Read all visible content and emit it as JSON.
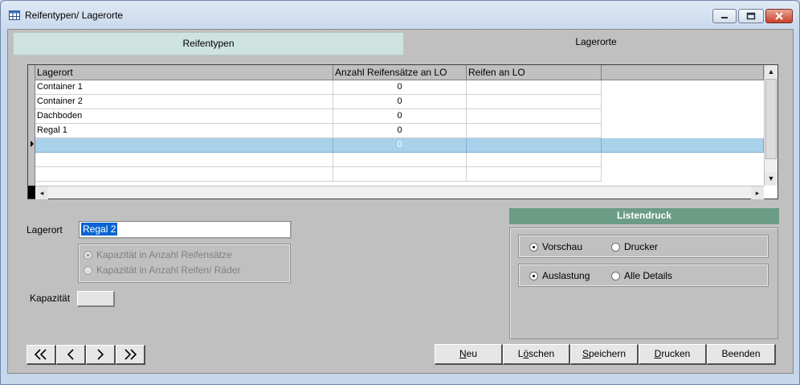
{
  "window": {
    "title": "Reifentypen/ Lagerorte",
    "icon": "table-icon",
    "controls": {
      "minimize": "minimize-icon",
      "maximize": "maximize-icon",
      "close": "close-icon"
    }
  },
  "tabs": [
    {
      "label": "Reifentypen",
      "active": false
    },
    {
      "label": "Lagerorte",
      "active": true
    }
  ],
  "grid": {
    "columns": [
      "Lagerort",
      "Anzahl Reifensätze an LO",
      "Reifen an LO",
      ""
    ],
    "rows": [
      {
        "lagerort": "Container 1",
        "anzahl": "0",
        "reifen": ""
      },
      {
        "lagerort": "Container 2",
        "anzahl": "0",
        "reifen": ""
      },
      {
        "lagerort": "Dachboden",
        "anzahl": "0",
        "reifen": ""
      },
      {
        "lagerort": "Regal 1",
        "anzahl": "0",
        "reifen": ""
      },
      {
        "lagerort": "",
        "anzahl": "0",
        "reifen": "",
        "selected": true
      },
      {
        "lagerort": "",
        "anzahl": "",
        "reifen": ""
      },
      {
        "lagerort": "",
        "anzahl": "",
        "reifen": ""
      }
    ]
  },
  "form": {
    "lagerort_label": "Lagerort",
    "lagerort_value": "Regal 2",
    "capacity_options": [
      {
        "label": "Kapazität in Anzahl Reifensätze",
        "selected": true
      },
      {
        "label": "Kapazität in Anzahl Reifen/ Räder",
        "selected": false
      }
    ],
    "kapazitaet_label": "Kapazität",
    "kapazitaet_value": ""
  },
  "listendruck": {
    "title": "Listendruck",
    "output_options": [
      {
        "label": "Vorschau",
        "selected": true
      },
      {
        "label": "Drucker",
        "selected": false
      }
    ],
    "detail_options": [
      {
        "label": "Auslastung",
        "selected": true
      },
      {
        "label": "Alle Details",
        "selected": false
      }
    ]
  },
  "navigation": [
    "first-record-icon",
    "previous-record-icon",
    "next-record-icon",
    "last-record-icon"
  ],
  "actions": [
    {
      "label_u": "N",
      "label_rest": "eu"
    },
    {
      "label_pre": "L",
      "label_u": "ö",
      "label_rest": "schen"
    },
    {
      "label_u": "S",
      "label_rest": "peichern"
    },
    {
      "label_u": "D",
      "label_rest": "rucken"
    },
    {
      "label_u": "",
      "label_rest": "Beenden"
    }
  ],
  "colors": {
    "inactive_tab": "#cee3e0",
    "panel_header": "#6b9c86",
    "selected_row": "#a9d1ea",
    "selection_highlight": "#0a64d2"
  }
}
